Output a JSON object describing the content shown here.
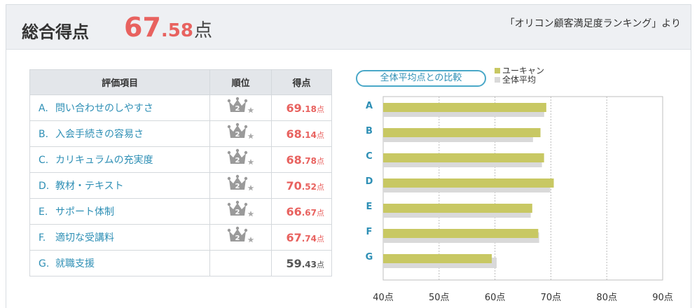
{
  "header": {
    "title": "総合得点",
    "score_int": "67",
    "score_dec": ".58",
    "score_unit": "点",
    "source": "「オリコン顧客満足度ランキング」より"
  },
  "table": {
    "headers": [
      "評価項目",
      "順位",
      "得点"
    ],
    "rows": [
      {
        "letter": "A.",
        "label": "問い合わせのしやすさ",
        "rank": 2,
        "score_int": "69",
        "score_dec": ".18",
        "unit": "点"
      },
      {
        "letter": "B.",
        "label": "入会手続きの容易さ",
        "rank": 2,
        "score_int": "68",
        "score_dec": ".14",
        "unit": "点"
      },
      {
        "letter": "C.",
        "label": "カリキュラムの充実度",
        "rank": 2,
        "score_int": "68",
        "score_dec": ".78",
        "unit": "点"
      },
      {
        "letter": "D.",
        "label": "教材・テキスト",
        "rank": 2,
        "score_int": "70",
        "score_dec": ".52",
        "unit": "点"
      },
      {
        "letter": "E.",
        "label": "サポート体制",
        "rank": 2,
        "score_int": "66",
        "score_dec": ".67",
        "unit": "点"
      },
      {
        "letter": "F.",
        "label": "適切な受講料",
        "rank": 2,
        "score_int": "67",
        "score_dec": ".74",
        "unit": "点"
      },
      {
        "letter": "G.",
        "label": "就職支援",
        "rank": null,
        "score_int": "59",
        "score_dec": ".43",
        "unit": "点"
      }
    ]
  },
  "compare_button": "全体平均点との比較",
  "icons": {
    "rank": "crown-icon",
    "star": "star-icon"
  },
  "colors": {
    "accent": "#e8625f",
    "link": "#2e8fb5",
    "company_bar": "#c8c863",
    "average_bar": "#d9d9d9"
  },
  "chart_data": {
    "type": "bar",
    "orientation": "horizontal",
    "categories": [
      "A",
      "B",
      "C",
      "D",
      "E",
      "F",
      "G"
    ],
    "series": [
      {
        "name": "ユーキャン",
        "values": [
          69.18,
          68.14,
          68.78,
          70.52,
          66.67,
          67.74,
          59.43
        ],
        "color": "#c8c863"
      },
      {
        "name": "全体平均",
        "values": [
          68.8,
          66.8,
          68.4,
          69.9,
          66.4,
          67.9,
          60.3
        ],
        "color": "#d9d9d9"
      }
    ],
    "xlim": [
      40,
      90
    ],
    "xticks": [
      "40点",
      "50点",
      "60点",
      "70点",
      "80点",
      "90点"
    ],
    "grid": true,
    "legend": "top-right"
  }
}
